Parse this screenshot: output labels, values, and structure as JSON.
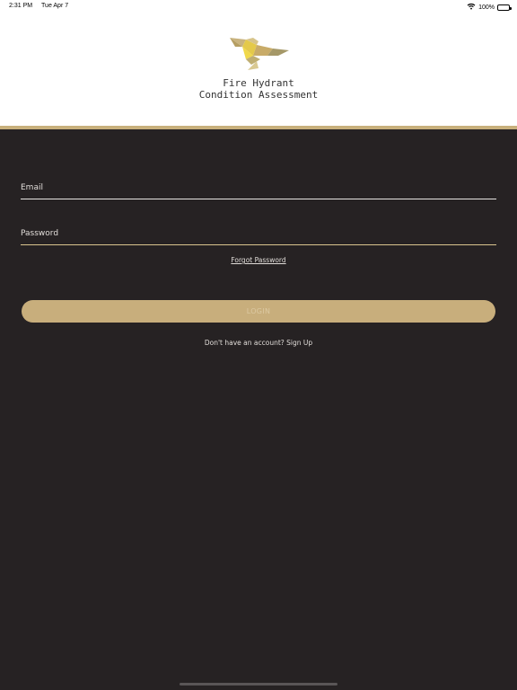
{
  "status_bar": {
    "time": "2:31 PM",
    "date": "Tue Apr 7",
    "battery": "100%",
    "icons": [
      "wifi-icon",
      "battery-icon"
    ]
  },
  "header": {
    "title_line1": "Fire Hydrant",
    "title_line2": "Condition Assessment",
    "logo": "bird-logo"
  },
  "form": {
    "email_placeholder": "Email",
    "password_placeholder": "Password",
    "forgot_label": "Forgot Password",
    "login_label": "LOGIN",
    "signup_label": "Don't have an account? Sign Up"
  },
  "colors": {
    "background": "#262223",
    "accent": "#c8ae7c",
    "header_bg": "#ffffff"
  }
}
